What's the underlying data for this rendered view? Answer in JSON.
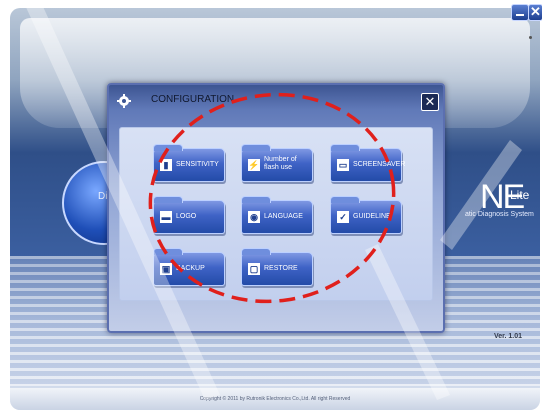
{
  "app": {
    "left_text": "Diag",
    "logo_text": "NE",
    "logo_suffix": "Lite",
    "logo_subtitle": "atic Diagnosis System",
    "version": "Ver. 1.01",
    "footer": "Copyright © 2011 by Rutronik Electronics Co.,Ltd. All right Reserved"
  },
  "window_controls": {
    "minimize_icon": "minimize-icon",
    "close_icon": "close-icon",
    "close_glyph": "✕"
  },
  "dialog": {
    "title": "CONFIGURATION",
    "close_glyph": "✕",
    "buttons": [
      {
        "id": "sensitivity",
        "label": "SENSITIVITY",
        "icon": "sensitivity-icon",
        "glyph": "▮"
      },
      {
        "id": "flash",
        "label_line1": "Number of",
        "label_line2": "flash use",
        "icon": "flash-icon",
        "glyph": "⚡"
      },
      {
        "id": "screensaver",
        "label": "SCREENSAVER",
        "icon": "monitor-icon",
        "glyph": "▭"
      },
      {
        "id": "logo",
        "label": "LOGO",
        "icon": "logo-icon",
        "glyph": "▬"
      },
      {
        "id": "language",
        "label": "LANGUAGE",
        "icon": "globe-icon",
        "glyph": "◉"
      },
      {
        "id": "guideline",
        "label": "GUIDELINE",
        "icon": "checkbox-icon",
        "glyph": "✓"
      },
      {
        "id": "backup",
        "label": "BACKUP",
        "icon": "disk-icon",
        "glyph": "▣"
      },
      {
        "id": "restore",
        "label": "RESTORE",
        "icon": "restore-icon",
        "glyph": "▢"
      }
    ]
  },
  "colors": {
    "annotation_red": "#e0201c",
    "accent_blue": "#2f57c0"
  }
}
